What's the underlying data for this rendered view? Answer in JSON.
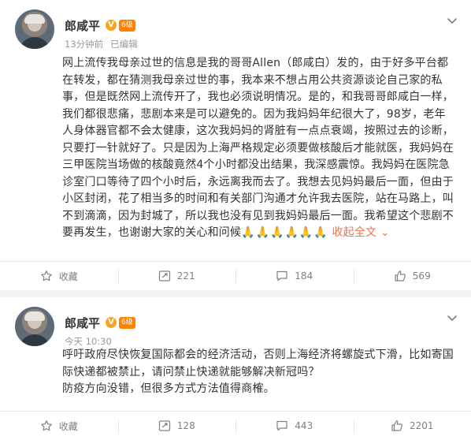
{
  "posts": [
    {
      "author": "郎咸平",
      "badge_v": "V",
      "badge_level": "6级",
      "time": "13分钟前",
      "edited": "已编辑",
      "text_main": "网上流传我母亲过世的信息是我的哥哥Allen（郎咸白）发的，由于好多平台都在转发，都在猜测我母亲过世的事，我本来不想占用公共资源谈论自己家的私事，但是既然网上流传开了，我也必须说明情况。是的，和我哥哥郎咸白一样，我们都很悲痛，悲剧本来是可以避免的。因为我妈妈年纪很大了，98岁，老年人身体器官都不会太健康，这次我妈妈的肾脏有一点点衰竭，按照过去的诊断，只要打一针就好了。只是因为上海严格规定必须要做核酸后才能就医，我妈妈在三甲医院当场做的核酸竟然4个小时都没出结果，我深感震惊。我妈妈在医院急诊室门口等待了四个小时后，永远离我而去了。我想去见妈妈最后一面，但由于小区封闭，花了相当多的时间和有关部门沟通才允许我去医院，站在马路上，叫不到滴滴，因为封城了，所以我也没有见到我妈妈最后一面。我希望这个悲剧不要再发生，也谢谢大家的关心和问候",
      "emoji": "🙏🙏🙏🙏🙏🙏",
      "collapse": "收起全文 ⌄",
      "actions": {
        "favorite": "收藏",
        "repost": "221",
        "comment": "184",
        "like": "569"
      }
    },
    {
      "author": "郎咸平",
      "badge_v": "V",
      "badge_level": "6级",
      "time": "今天 10:30",
      "line1": "呼吁政府尽快恢复国际都会的经济活动，否则上海经济将螺旋式下滑，比如寄国际快递都被禁止，请问禁止快递就能够解决新冠吗？",
      "line2": "防疫方向没错，但很多方式方法值得商榷。",
      "actions": {
        "favorite": "收藏",
        "repost": "128",
        "comment": "443",
        "like": "2201"
      }
    }
  ],
  "icons": {
    "more": "chevron-down-icon",
    "favorite": "star-icon",
    "repost": "repost-icon",
    "comment": "comment-icon",
    "like": "thumbs-up-icon"
  },
  "colors": {
    "link": "#eb7350",
    "verified": "#f5a623",
    "level": "#ff8200",
    "muted": "#808080"
  }
}
